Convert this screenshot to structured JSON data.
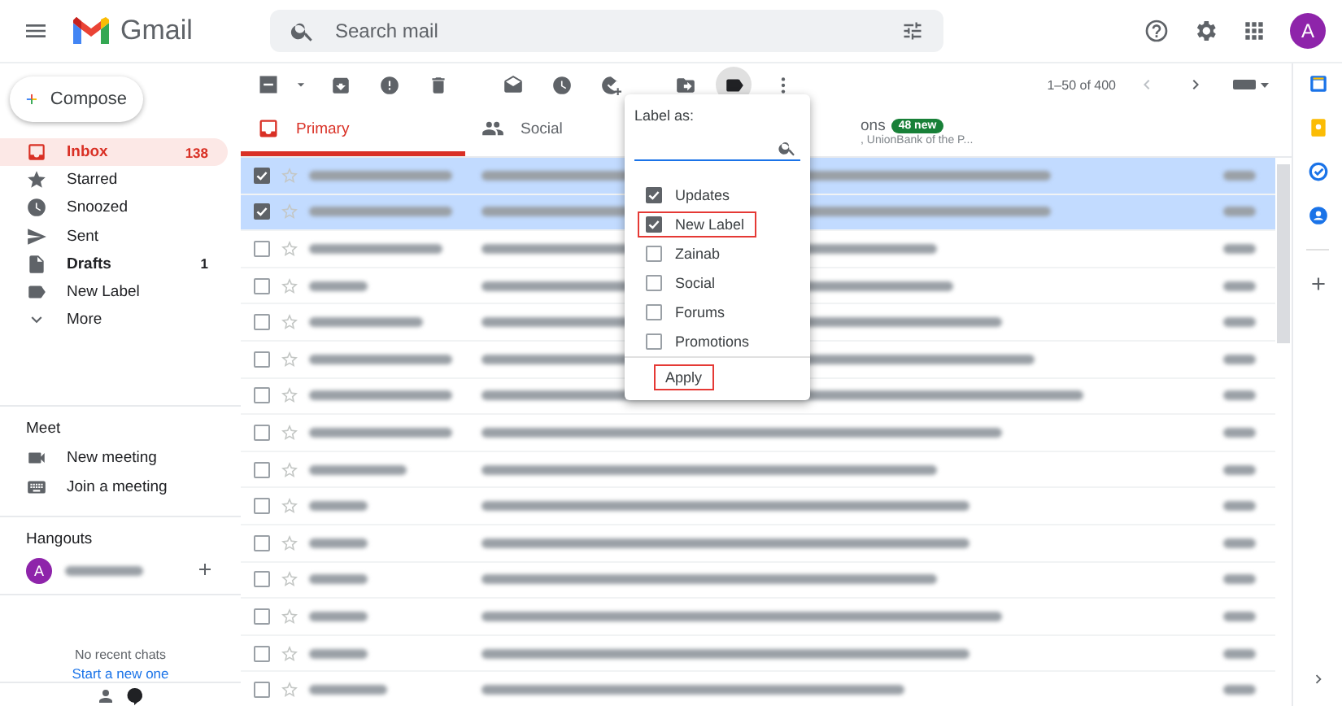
{
  "header": {
    "app_name": "Gmail",
    "search": {
      "placeholder": "Search mail"
    },
    "avatar": "A"
  },
  "compose": "Compose",
  "sidebar": {
    "items": [
      {
        "label": "Inbox",
        "count": "138",
        "selected": true,
        "bold": true
      },
      {
        "label": "Starred",
        "selected": false,
        "bold": false
      },
      {
        "label": "Snoozed",
        "selected": false,
        "bold": false
      },
      {
        "label": "Sent",
        "selected": false,
        "bold": false
      },
      {
        "label": "Drafts",
        "count": "1",
        "selected": false,
        "bold": true
      },
      {
        "label": "New Label",
        "selected": false,
        "bold": false
      },
      {
        "label": "More",
        "selected": false,
        "bold": false
      }
    ],
    "meet": {
      "title": "Meet",
      "items": [
        {
          "label": "New meeting"
        },
        {
          "label": "Join a meeting"
        }
      ]
    },
    "hangouts": {
      "title": "Hangouts",
      "avatar": "A",
      "empty_text": "No recent chats",
      "link": "Start a new one"
    }
  },
  "toolbar": {
    "pagination": "1–50 of 400"
  },
  "tabs": [
    {
      "label": "Primary",
      "selected": true
    },
    {
      "label": "Social",
      "selected": false
    },
    {
      "label": "ons",
      "badge": "48 new",
      "subtitle": ", UnionBank of the P...",
      "selected": false
    }
  ],
  "rows": [
    {
      "checked": true
    },
    {
      "checked": true
    },
    {
      "checked": false
    },
    {
      "checked": false
    },
    {
      "checked": false
    },
    {
      "checked": false
    },
    {
      "checked": false
    },
    {
      "checked": false
    },
    {
      "checked": false
    },
    {
      "checked": false
    },
    {
      "checked": false
    },
    {
      "checked": false
    },
    {
      "checked": false
    },
    {
      "checked": false
    },
    {
      "checked": false
    }
  ],
  "label_menu": {
    "title": "Label as:",
    "items": [
      {
        "label": "Updates",
        "checked": true,
        "highlighted": false
      },
      {
        "label": "New Label",
        "checked": true,
        "highlighted": true
      },
      {
        "label": "Zainab",
        "checked": false,
        "highlighted": false
      },
      {
        "label": "Social",
        "checked": false,
        "highlighted": false
      },
      {
        "label": "Forums",
        "checked": false,
        "highlighted": false
      },
      {
        "label": "Promotions",
        "checked": false,
        "highlighted": false
      }
    ],
    "apply": {
      "label": "Apply",
      "highlighted": true
    }
  }
}
